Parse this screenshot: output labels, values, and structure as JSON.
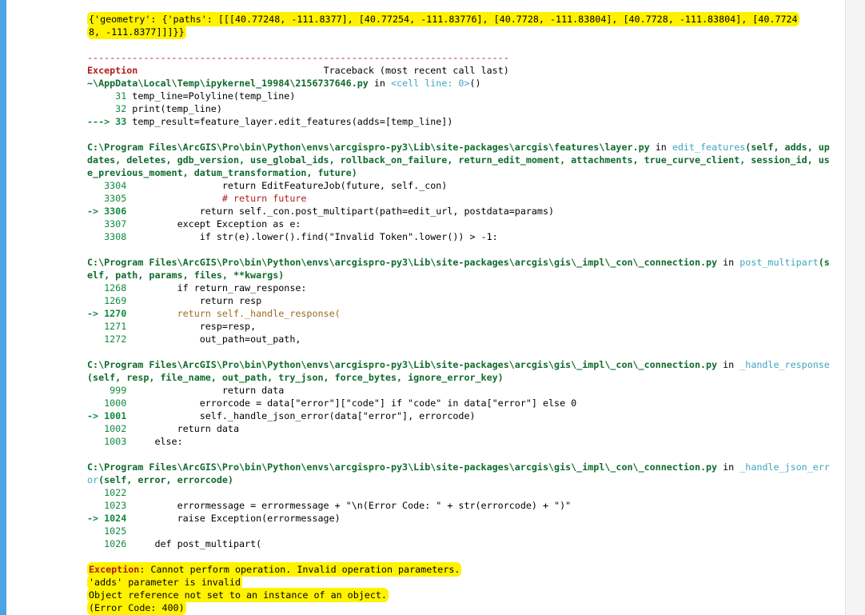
{
  "geometry_output": {
    "line1": "{'geometry': {'paths': [[[40.77248, -111.8377], [40.77254, -111.83776], [40.7728, -111.83804], [40.7728, -111.83804], [40.7724",
    "line2": "8, -111.8377]]]}}"
  },
  "separator": "---------------------------------------------------------------------------",
  "traceback_header": {
    "exception": "Exception",
    "traceback_label": "Traceback (most recent call last)"
  },
  "frame1": {
    "file": "~\\AppData\\Local\\Temp\\ipykernel_19984\\2156737646.py",
    "in": " in ",
    "func": "<cell line: 0>",
    "suffix": "()",
    "lines": [
      {
        "marker": "     31 ",
        "code": "temp_line=Polyline(temp_line)"
      },
      {
        "marker": "     32 ",
        "code": "print(temp_line)"
      },
      {
        "marker": "---> 33 ",
        "code": "temp_result=feature_layer.edit_features(adds=[temp_line])"
      }
    ]
  },
  "frame2": {
    "file": "C:\\Program Files\\ArcGIS\\Pro\\bin\\Python\\envs\\arcgispro-py3\\Lib\\site-packages\\arcgis\\features\\layer.py",
    "in": " in ",
    "func": "edit_features",
    "signature": "(self, adds, updates, deletes, gdb_version, use_global_ids, rollback_on_failure, return_edit_moment, attachments, true_curve_client, session_id, use_previous_moment, datum_transformation, future)",
    "lines": [
      {
        "marker": "   3304 ",
        "code": "                return EditFeatureJob(future, self._con)"
      },
      {
        "marker": "   3305 ",
        "code": "                # return future"
      },
      {
        "marker": "-> 3306 ",
        "code": "            return self._con.post_multipart(path=edit_url, postdata=params)"
      },
      {
        "marker": "   3307 ",
        "code": "        except Exception as e:"
      },
      {
        "marker": "   3308 ",
        "code": "            if str(e).lower().find(\"Invalid Token\".lower()) > -1:"
      }
    ]
  },
  "frame3": {
    "file": "C:\\Program Files\\ArcGIS\\Pro\\bin\\Python\\envs\\arcgispro-py3\\Lib\\site-packages\\arcgis\\gis\\_impl\\_con\\_connection.py",
    "in": " in ",
    "func": "post_multipart",
    "signature": "(self, path, params, files, **kwargs)",
    "lines": [
      {
        "marker": "   1268 ",
        "code": "        if return_raw_response:"
      },
      {
        "marker": "   1269 ",
        "code": "            return resp"
      },
      {
        "marker": "-> 1270 ",
        "code": "        return self._handle_response("
      },
      {
        "marker": "   1271 ",
        "code": "            resp=resp,"
      },
      {
        "marker": "   1272 ",
        "code": "            out_path=out_path,"
      }
    ]
  },
  "frame4": {
    "file": "C:\\Program Files\\ArcGIS\\Pro\\bin\\Python\\envs\\arcgispro-py3\\Lib\\site-packages\\arcgis\\gis\\_impl\\_con\\_connection.py",
    "in": " in ",
    "func": "_handle_response",
    "signature": "(self, resp, file_name, out_path, try_json, force_bytes, ignore_error_key)",
    "lines": [
      {
        "marker": "    999 ",
        "code": "                return data"
      },
      {
        "marker": "   1000 ",
        "code": "            errorcode = data[\"error\"][\"code\"] if \"code\" in data[\"error\"] else 0"
      },
      {
        "marker": "-> 1001 ",
        "code": "            self._handle_json_error(data[\"error\"], errorcode)"
      },
      {
        "marker": "   1002 ",
        "code": "        return data"
      },
      {
        "marker": "   1003 ",
        "code": "    else:"
      }
    ]
  },
  "frame5": {
    "file": "C:\\Program Files\\ArcGIS\\Pro\\bin\\Python\\envs\\arcgispro-py3\\Lib\\site-packages\\arcgis\\gis\\_impl\\_con\\_connection.py",
    "in": " in ",
    "func": "_handle_json_error",
    "signature": "(self, error, errorcode)",
    "lines": [
      {
        "marker": "   1022 ",
        "code": ""
      },
      {
        "marker": "   1023 ",
        "code": "        errormessage = errormessage + \"\\n(Error Code: \" + str(errorcode) + \")\""
      },
      {
        "marker": "-> 1024 ",
        "code": "        raise Exception(errormessage)"
      },
      {
        "marker": "   1025 ",
        "code": ""
      },
      {
        "marker": "   1026 ",
        "code": "    def post_multipart("
      }
    ]
  },
  "final_error": {
    "exception": "Exception",
    "message": ": Cannot perform operation. Invalid operation parameters.",
    "line2": "'adds' parameter is invalid",
    "line3": "Object reference not set to an instance of an object.",
    "line4": "(Error Code: 400)"
  },
  "colors": {
    "cell_border": "#4ea3e4",
    "highlight": "#fff200",
    "exception_red": "#b11d1d",
    "frame_green": "#118a3e",
    "function_cyan": "#40a6bf"
  }
}
